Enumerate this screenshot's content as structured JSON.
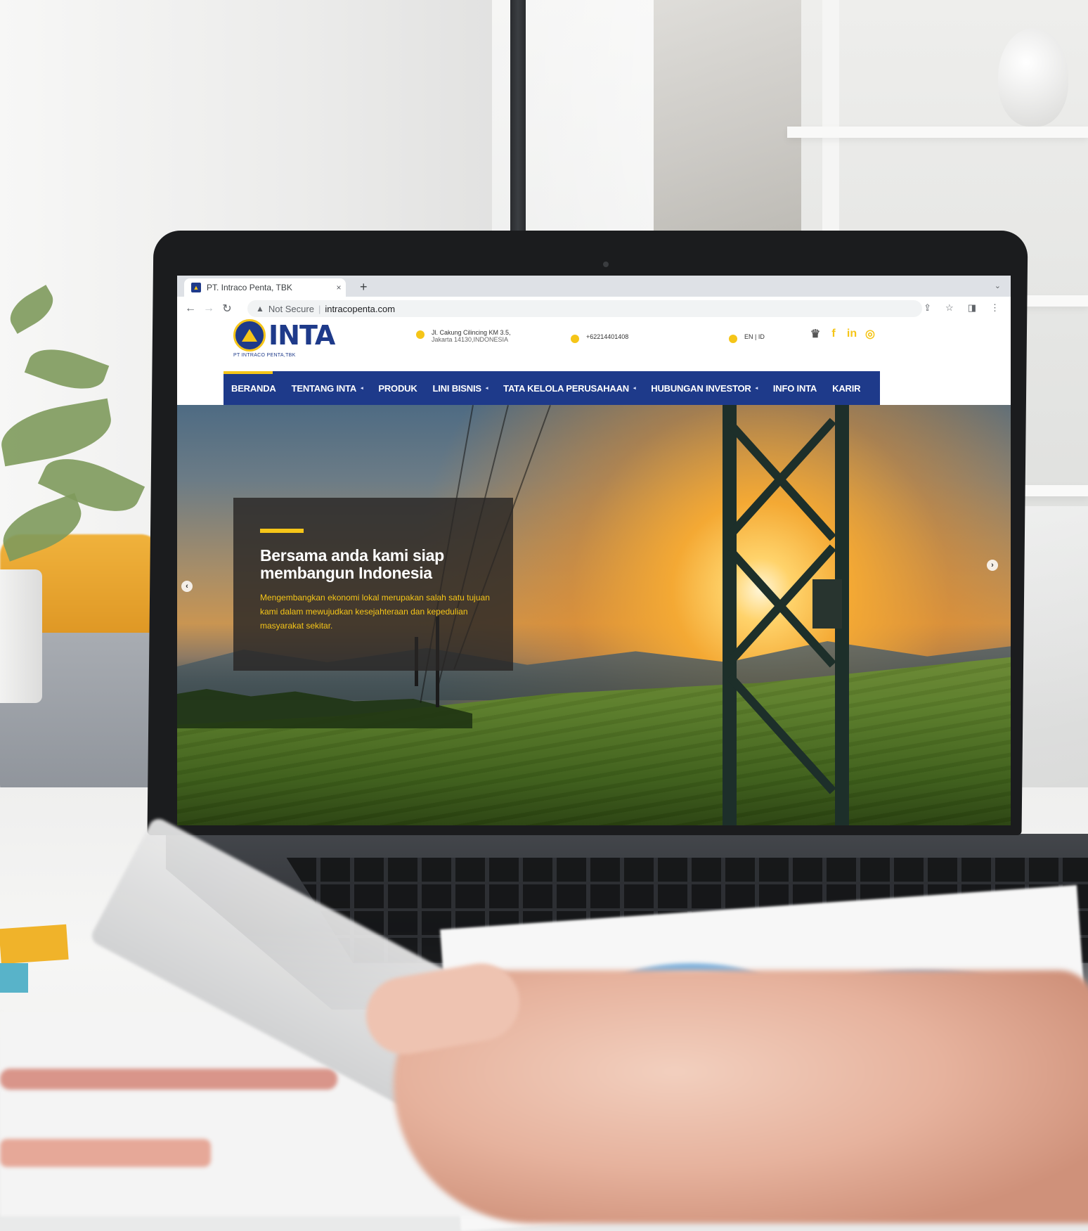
{
  "browser": {
    "tab_title": "PT. Intraco Penta, TBK",
    "tab_close": "×",
    "new_tab": "+",
    "security_label": "Not Secure",
    "url": "intracopenta.com"
  },
  "site": {
    "logo_text": "INTA",
    "logo_subtitle": "PT INTRACO PENTA,TBK",
    "address_line1": "Jl. Cakung Cilincing KM 3.5,",
    "address_line2": "Jakarta 14130,INDONESIA",
    "phone": "+62214401408",
    "language": "EN | ID"
  },
  "nav": {
    "items": [
      {
        "label": "BERANDA",
        "caret": false
      },
      {
        "label": "TENTANG INTA",
        "caret": true
      },
      {
        "label": "PRODUK",
        "caret": false
      },
      {
        "label": "LINI BISNIS",
        "caret": true
      },
      {
        "label": "TATA KELOLA PERUSAHAAN",
        "caret": true
      },
      {
        "label": "HUBUNGAN INVESTOR",
        "caret": true
      },
      {
        "label": "INFO INTA",
        "caret": false
      },
      {
        "label": "KARIR",
        "caret": false
      }
    ]
  },
  "hero": {
    "title": "Bersama anda kami siap membangun Indonesia",
    "text": "Mengembangkan ekonomi lokal merupakan salah satu tujuan kami dalam mewujudkan kesejahteraan dan kepedulian masyarakat sekitar.",
    "prev_arrow": "‹",
    "next_arrow": "›"
  },
  "colors": {
    "brand_blue": "#1e3a8a",
    "brand_yellow": "#f5c518"
  },
  "icons": [
    "back-icon",
    "forward-icon",
    "reload-icon",
    "warning-icon",
    "share-icon",
    "star-icon",
    "sidepanel-icon",
    "kebab-menu-icon",
    "location-icon",
    "phone-icon",
    "globe-icon",
    "award-icon",
    "facebook-icon",
    "linkedin-icon",
    "instagram-icon"
  ]
}
